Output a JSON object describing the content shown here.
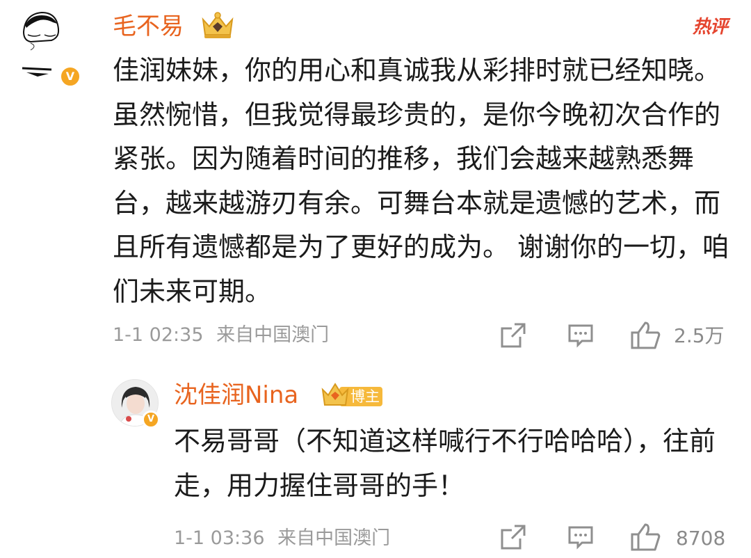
{
  "hot_label": "热评",
  "comment": {
    "user_name": "毛不易",
    "badge_icon": "crown-badge-icon",
    "verified_icon": "verified-v-icon",
    "text": "佳润妹妹，你的用心和真诚我从彩排时就已经知晓。虽然惋惜，但我觉得最珍贵的，是你今晚初次合作的紧张。因为随着时间的推移，我们会越来越熟悉舞台，越来越游刃有余。可舞台本就是遗憾的艺术，而且所有遗憾都是为了更好的成为。 谢谢你的一切，咱们未来可期。",
    "time": "1-1 02:35",
    "source": "来自中国澳门",
    "like_count": "2.5万"
  },
  "reply": {
    "user_name": "沈佳润Nina",
    "badge_label": "博主",
    "verified_icon": "verified-v-icon",
    "text": "不易哥哥（不知道这样喊行不行哈哈哈），往前走，用力握住哥哥的手！",
    "time": "1-1 03:36",
    "source": "来自中国澳门",
    "like_count": "8708"
  },
  "colors": {
    "name": "#e8641f",
    "hot": "#e5452f",
    "meta": "#9a9a9a",
    "text": "#1b1b1b",
    "badge": "#f5a623"
  }
}
